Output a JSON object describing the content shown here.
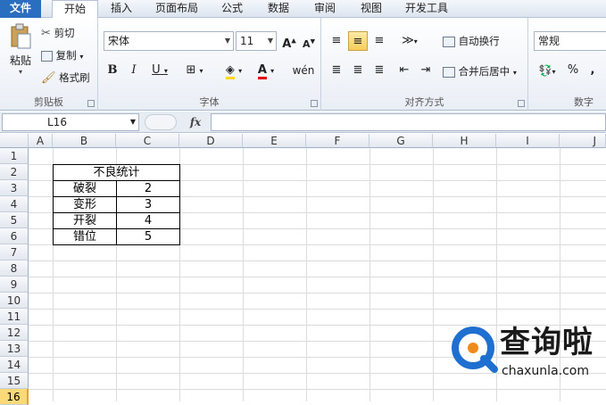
{
  "tabs": {
    "file": "文件",
    "items": [
      "开始",
      "插入",
      "页面布局",
      "公式",
      "数据",
      "审阅",
      "视图",
      "开发工具"
    ]
  },
  "clipboard": {
    "paste": "粘贴",
    "cut": "剪切",
    "copy": "复制",
    "painter": "格式刷",
    "label": "剪贴板"
  },
  "font": {
    "name": "宋体",
    "size": "11",
    "label": "字体"
  },
  "align": {
    "wrap": "自动换行",
    "merge": "合并后居中",
    "label": "对齐方式"
  },
  "number": {
    "format": "常规",
    "label": "数字",
    "percent": "%",
    "comma": ","
  },
  "formula": {
    "name_box": "L16",
    "fx": "fx"
  },
  "columns": [
    "A",
    "B",
    "C",
    "D",
    "E",
    "F",
    "G",
    "H",
    "I",
    "J"
  ],
  "rows": [
    "1",
    "2",
    "3",
    "4",
    "5",
    "6",
    "7",
    "8",
    "9",
    "10",
    "11",
    "12",
    "13",
    "14",
    "15",
    "16"
  ],
  "table": {
    "title": "不良统计",
    "rows": [
      {
        "label": "破裂",
        "value": "2"
      },
      {
        "label": "变形",
        "value": "3"
      },
      {
        "label": "开裂",
        "value": "4"
      },
      {
        "label": "错位",
        "value": "5"
      }
    ]
  },
  "watermark": {
    "brand": "查询啦",
    "url": "chaxunla.com",
    "color": "#1f6fd0"
  }
}
